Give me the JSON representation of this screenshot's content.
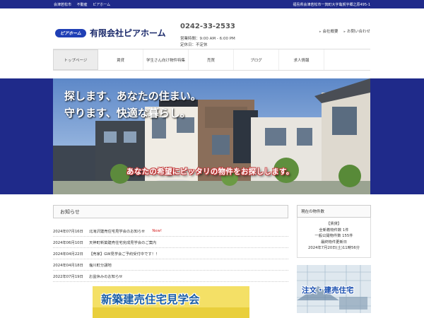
{
  "topbar": {
    "left_items": [
      "会津若松市",
      "不動産",
      "ピアホーム"
    ],
    "address": "福島県会津若松市一箕町大字亀賀字郷之原495-1"
  },
  "header": {
    "logo_badge": "ピアホーム",
    "company_name": "有限会社ピアホーム",
    "phone": "0242-33-2533",
    "hours": "営業時間：9:00 AM - 6:00 PM",
    "holiday": "定休日：不定休",
    "links": [
      "会社概要",
      "お問い合わせ"
    ]
  },
  "nav": {
    "items": [
      "トップページ",
      "賃貸",
      "学生さん向け物件特集",
      "売買",
      "ブログ",
      "求人情報"
    ],
    "active_index": 0
  },
  "hero": {
    "line1": "探します、あなたの住まい。",
    "line2": "守ります、快適な暮らし。",
    "slogan": "あなたの希望にピッタリの物件をお探しします。"
  },
  "news": {
    "title": "お知らせ",
    "items": [
      {
        "date": "2024年07月16日",
        "text": "北滝沢建売住宅見学会のお知らせ",
        "badge": "New!"
      },
      {
        "date": "2024年06月10日",
        "text": "天神町新築建売住宅完成見学会のご案内",
        "badge": ""
      },
      {
        "date": "2024年04月22日",
        "text": "【売家】GW見学会ご予約受付中です！！",
        "badge": ""
      },
      {
        "date": "2024年04月18日",
        "text": "塩川町分譲地",
        "badge": ""
      },
      {
        "date": "2022年07月19日",
        "text": "お盆休みのお知らせ",
        "badge": ""
      }
    ]
  },
  "sidebar": {
    "title": "現在の物件数",
    "category": "【賃貸】",
    "new_count": "全新着物件数 1件",
    "public_count": "一般公開物件数 155件",
    "updated_label": "最終物件更新日",
    "updated": "2024年7月20日(土)11時56分"
  },
  "banners": {
    "open_house": "新築建売住宅見学会",
    "custom_home": "注文・建売住宅"
  },
  "colors": {
    "brand_navy": "#1f2a8a",
    "logo_blue": "#1f3fb5",
    "new_badge": "#d62020",
    "banner_yellow": "#f4e066"
  }
}
